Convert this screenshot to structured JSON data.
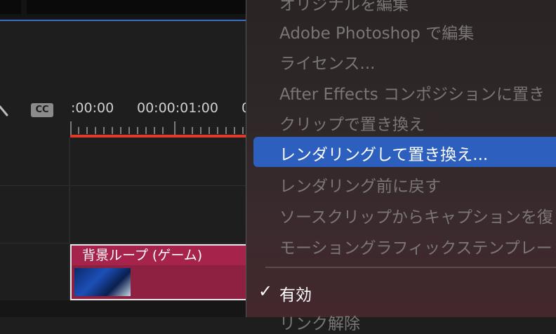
{
  "timeline": {
    "timecode_1": ":00:00",
    "timecode_2": "00:00:01:00",
    "timecode_3": "0",
    "cc_label": "CC",
    "clip_title": "背景ループ (ゲーム)"
  },
  "menu": {
    "items": [
      "オリジナルを編集",
      "Adobe Photoshop で編集",
      "ライセンス...",
      "After Effects コンポジションに置き",
      "クリップで置き換え",
      "レンダリングして置き換え...",
      "レンダリング前に戻す",
      "ソースクリップからキャプションを復",
      "モーショングラフィックステンプレー",
      "有効",
      "リンク解除"
    ],
    "enabled_check": "✓"
  },
  "colors": {
    "highlight": "#2d5fbe",
    "playhead_bar": "#e03a2a",
    "clip": "#a6244c"
  }
}
